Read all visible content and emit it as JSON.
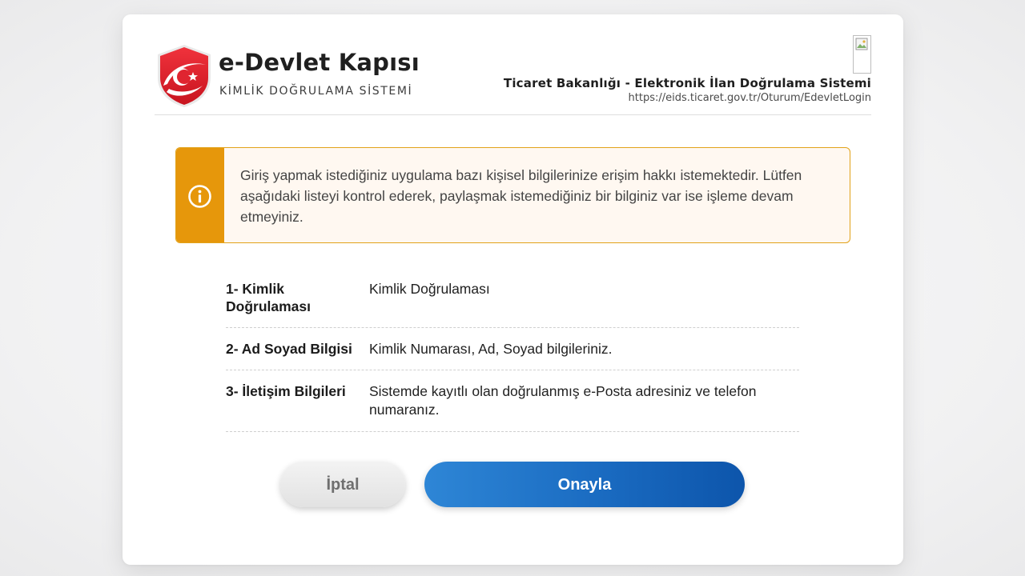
{
  "brand": {
    "title": "e-Devlet Kapısı",
    "subtitle": "KİMLİK DOĞRULAMA SİSTEMİ",
    "emblem_color": "#e8232f"
  },
  "app": {
    "name": "Ticaret Bakanlığı - Elektronik İlan Doğrulama Sistemi",
    "url": "https://eids.ticaret.gov.tr/Oturum/EdevletLogin",
    "logo_icon": "broken-image-icon"
  },
  "warning": {
    "icon": "info-icon",
    "text": "Giriş yapmak istediğiniz uygulama bazı kişisel bilgilerinize erişim hakkı istemektedir. Lütfen aşağıdaki listeyi kontrol ederek, paylaşmak istemediğiniz bir bilginiz var ise işleme devam etmeyiniz.",
    "accent_color": "#e6970b"
  },
  "permissions": [
    {
      "name": "1- Kimlik Doğrulaması",
      "description": "Kimlik Doğrulaması"
    },
    {
      "name": "2- Ad Soyad Bilgisi",
      "description": "Kimlik Numarası, Ad, Soyad bilgileriniz."
    },
    {
      "name": "3- İletişim Bilgileri",
      "description": "Sistemde kayıtlı olan doğrulanmış e-Posta adresiniz ve telefon numaranız."
    }
  ],
  "actions": {
    "cancel_label": "İptal",
    "confirm_label": "Onayla",
    "confirm_color": "#1a6bc1"
  }
}
